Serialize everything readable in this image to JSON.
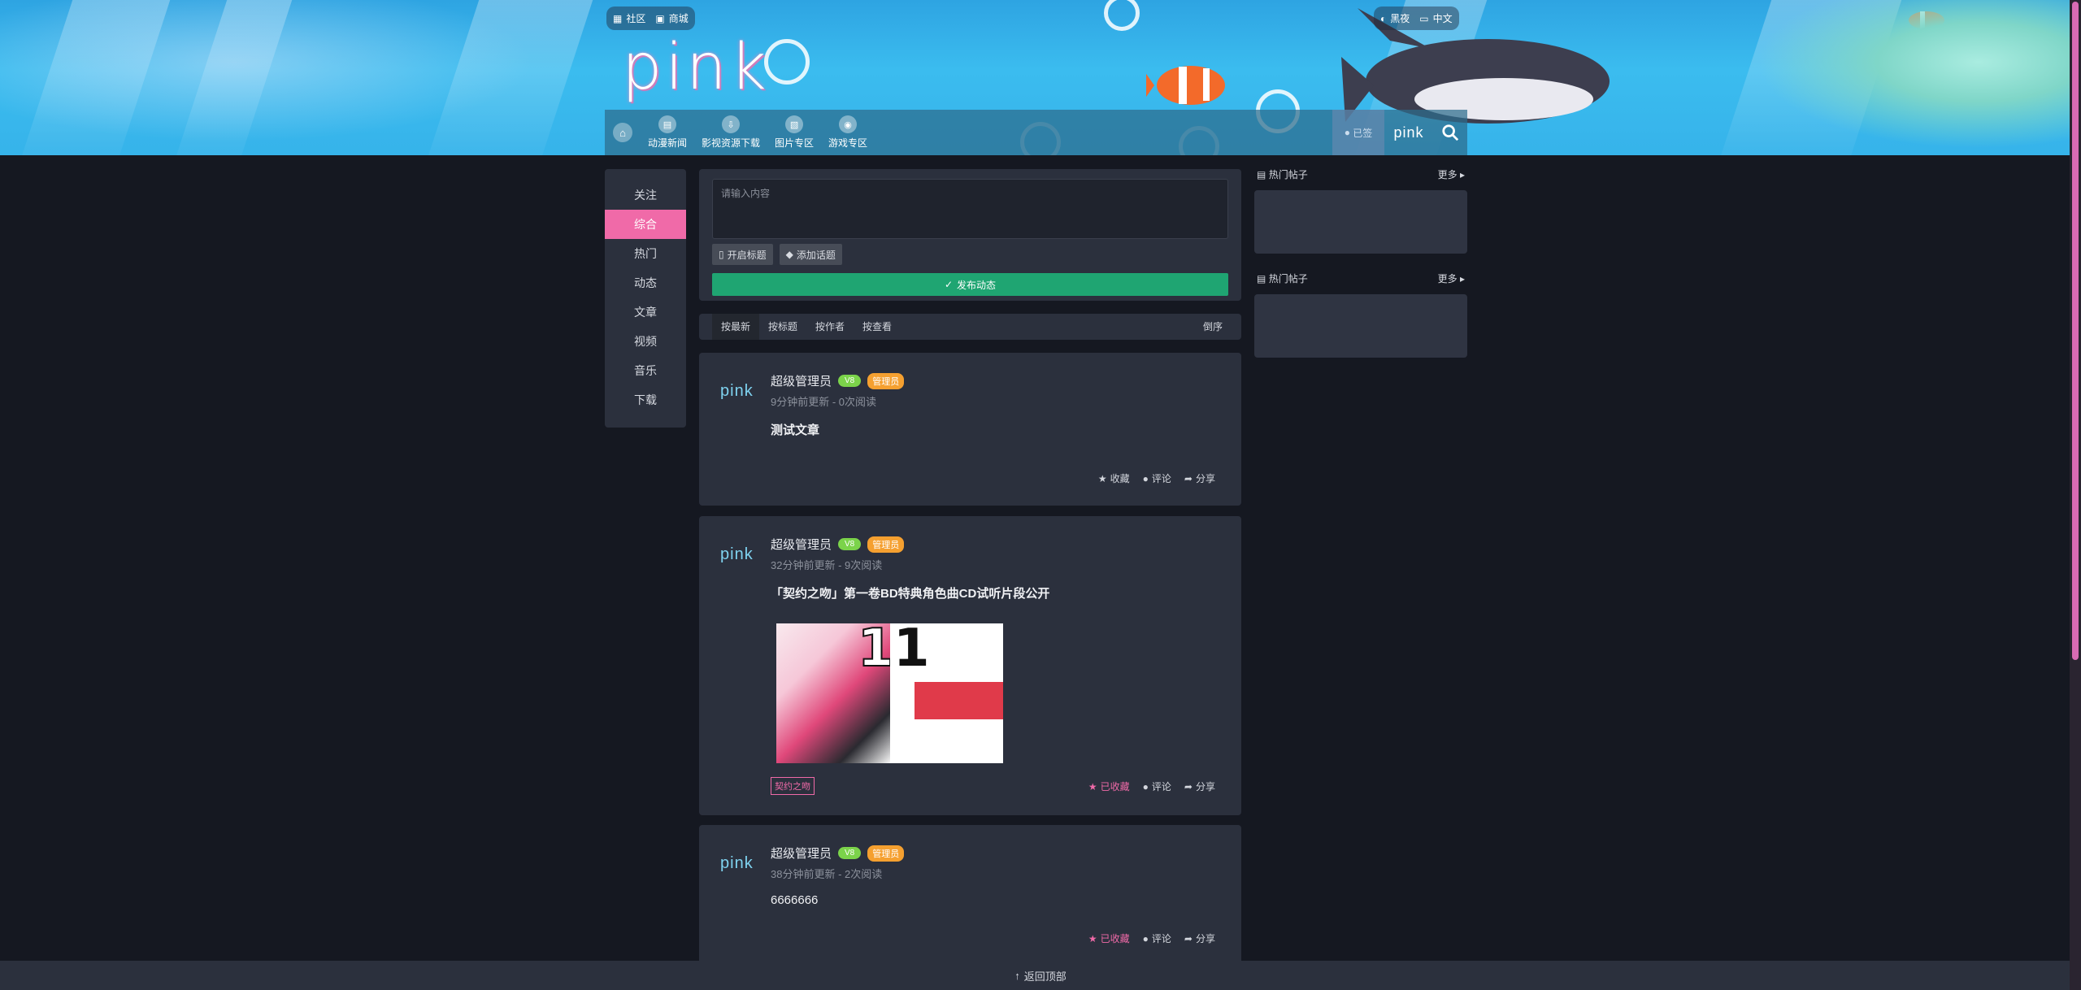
{
  "topbar": {
    "community": "社区",
    "mall": "商城",
    "night": "黑夜",
    "language": "中文"
  },
  "brand": {
    "logo_text": "pink"
  },
  "nav": {
    "items": [
      {
        "label": "动漫新闻"
      },
      {
        "label": "影视资源下载"
      },
      {
        "label": "图片专区"
      },
      {
        "label": "游戏专区"
      }
    ],
    "signin": "已签",
    "small_logo": "pink"
  },
  "leftnav": {
    "items": [
      "关注",
      "综合",
      "热门",
      "动态",
      "文章",
      "视频",
      "音乐",
      "下载"
    ],
    "active_index": 1
  },
  "composer": {
    "placeholder": "请输入内容",
    "title_btn": "开启标题",
    "topic_btn": "添加话题",
    "publish": "发布动态"
  },
  "sort": {
    "items": [
      "按最新",
      "按标题",
      "按作者",
      "按查看"
    ],
    "reverse": "倒序"
  },
  "posts": [
    {
      "avatar": "pink",
      "author": "超级管理员",
      "level": "V8",
      "role": "管理员",
      "meta": "9分钟前更新 - 0次阅读",
      "title": "测试文章",
      "fav": "收藏",
      "comment": "评论",
      "share": "分享"
    },
    {
      "avatar": "pink",
      "author": "超级管理员",
      "level": "V8",
      "role": "管理员",
      "meta": "32分钟前更新 - 9次阅读",
      "title": "「契约之吻」第一卷BD特典角色曲CD试听片段公开",
      "tag": "契约之吻",
      "fav": "已收藏",
      "comment": "评论",
      "share": "分享"
    },
    {
      "avatar": "pink",
      "author": "超级管理员",
      "level": "V8",
      "role": "管理员",
      "meta": "38分钟前更新 - 2次阅读",
      "title": "6666666",
      "fav": "已收藏",
      "comment": "评论",
      "share": "分享"
    }
  ],
  "side": [
    {
      "title": "热门帖子",
      "more": "更多"
    },
    {
      "title": "热门帖子",
      "more": "更多"
    }
  ],
  "footer": {
    "back_top": "返回顶部"
  },
  "colors": {
    "accent": "#f06aa8",
    "publish": "#1fa572",
    "bg": "#151821",
    "card": "#2b303d"
  }
}
